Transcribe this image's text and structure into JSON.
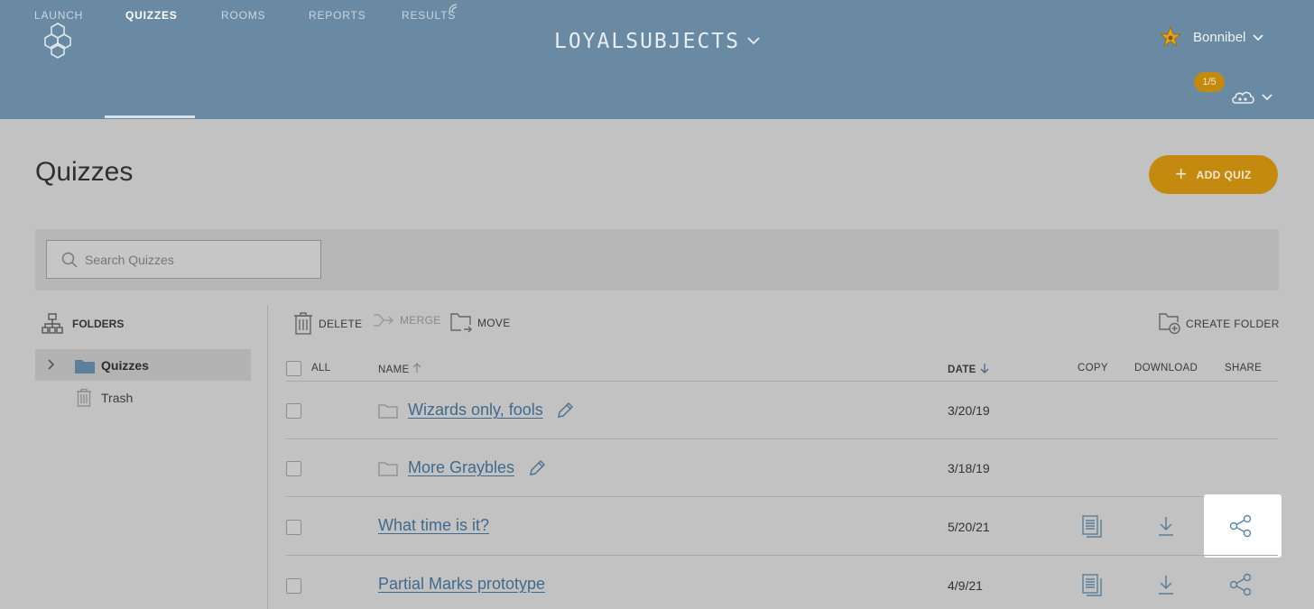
{
  "header": {
    "room_name": "LOYALSUBJECTS",
    "user_name": "Bonnibel",
    "badge": "1/5",
    "nav": [
      "LAUNCH",
      "QUIZZES",
      "ROOMS",
      "REPORTS",
      "RESULTS"
    ],
    "active_nav": "QUIZZES"
  },
  "page": {
    "title": "Quizzes",
    "add_button": "ADD QUIZ",
    "search_placeholder": "Search Quizzes"
  },
  "sidebar": {
    "heading": "FOLDERS",
    "folders": [
      "Quizzes"
    ],
    "trash": "Trash"
  },
  "toolbar": {
    "delete": "DELETE",
    "merge": "MERGE",
    "move": "MOVE",
    "create_folder": "CREATE FOLDER"
  },
  "table": {
    "columns": {
      "all": "ALL",
      "name": "NAME",
      "date": "DATE",
      "copy": "COPY",
      "download": "DOWNLOAD",
      "share": "SHARE"
    },
    "rows": [
      {
        "name": "Wizards only, fools",
        "date": "3/20/19",
        "is_folder": true
      },
      {
        "name": "More Graybles",
        "date": "3/18/19",
        "is_folder": true
      },
      {
        "name": "What time is it?",
        "date": "5/20/21",
        "is_folder": false
      },
      {
        "name": "Partial Marks prototype",
        "date": "4/9/21",
        "is_folder": false
      }
    ]
  },
  "colors": {
    "header_bg": "#6a8aa3",
    "accent": "#c48a10",
    "link": "#3f6a8e"
  }
}
